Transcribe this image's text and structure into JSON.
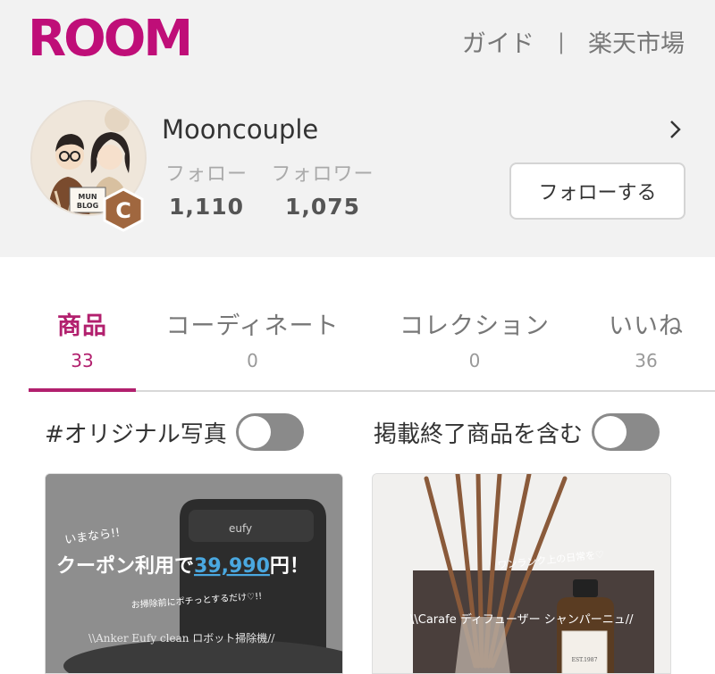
{
  "header": {
    "logo": "ROOM",
    "links": [
      "ガイド",
      "楽天市場"
    ],
    "separator": "|"
  },
  "profile": {
    "username": "Mooncouple",
    "badge_letter": "C",
    "following_label": "フォロー",
    "following_count": "1,110",
    "followers_label": "フォロワー",
    "followers_count": "1,075",
    "follow_button": "フォローする",
    "avatar_sign_text": "MUN BLOG"
  },
  "tabs": [
    {
      "label": "商品",
      "count": "33",
      "active": true
    },
    {
      "label": "コーディネート",
      "count": "0",
      "active": false
    },
    {
      "label": "コレクション",
      "count": "0",
      "active": false
    },
    {
      "label": "いいね",
      "count": "36",
      "active": false
    }
  ],
  "filters": {
    "original_photo_label": "#オリジナル写真",
    "original_photo_on": false,
    "include_ended_label": "掲載終了商品を含む",
    "include_ended_on": false
  },
  "products": [
    {
      "brand_on_device": "eufy",
      "line1": "いまなら!!",
      "line2_prefix": "クーポン利用で",
      "line2_price": "39,990",
      "line2_suffix": "円！",
      "line3": "お掃除前にポチっとするだけ♡!!",
      "line4": "\\\\Anker Eufy clean ロボット掃除機//"
    },
    {
      "line1": "ワンランク上の日常を♡",
      "line2": "\\\\Carafe ディフューザー シャンパーニュ//",
      "bottle_label": "EST.1987"
    }
  ],
  "colors": {
    "brand": "#bf0e78",
    "active_tab": "#b2206e",
    "header_bg": "#f2f2f2",
    "toggle_off": "#8a8a8a",
    "price_blue": "#4aa8e0"
  }
}
